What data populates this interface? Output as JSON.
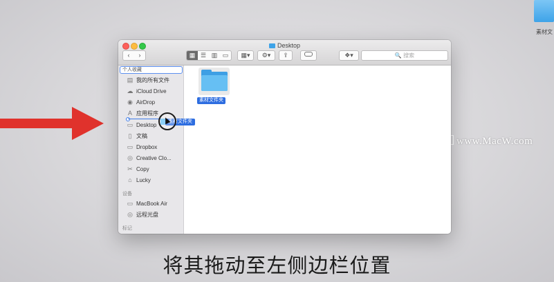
{
  "desktop": {
    "icon_label": "素材文"
  },
  "watermark": {
    "text": "www.MacW.com"
  },
  "caption": "将其拖动至左侧边栏位置",
  "window": {
    "title": "Desktop",
    "toolbar": {
      "back": "‹",
      "forward": "›",
      "views": [
        "▦",
        "☰",
        "▥",
        "▭"
      ],
      "arrange": "▦▾",
      "action": "⚙▾",
      "share": "⇪",
      "dropbox": "❖▾",
      "search_placeholder": "🔍 搜索"
    },
    "sidebar": {
      "favorites_title": "个人收藏",
      "favorites": [
        {
          "label": "我的所有文件",
          "icon": "▤"
        },
        {
          "label": "iCloud Drive",
          "icon": "☁"
        },
        {
          "label": "AirDrop",
          "icon": "◉"
        },
        {
          "label": "应用程序",
          "icon": "A"
        },
        {
          "label": "Desktop",
          "icon": "▭"
        },
        {
          "label": "文稿",
          "icon": "▯"
        },
        {
          "label": "Dropbox",
          "icon": "▭"
        },
        {
          "label": "Creative Clo...",
          "icon": "◎"
        },
        {
          "label": "Copy",
          "icon": "✂"
        },
        {
          "label": "Lucky",
          "icon": "⌂"
        }
      ],
      "devices_title": "设备",
      "devices": [
        {
          "label": "MacBook Air",
          "icon": "▭"
        },
        {
          "label": "远程光盘",
          "icon": "◎"
        }
      ],
      "tags_title": "标记"
    },
    "content": {
      "folder_label": "素材文件夹"
    }
  },
  "drag": {
    "label": "素材文件夹"
  }
}
